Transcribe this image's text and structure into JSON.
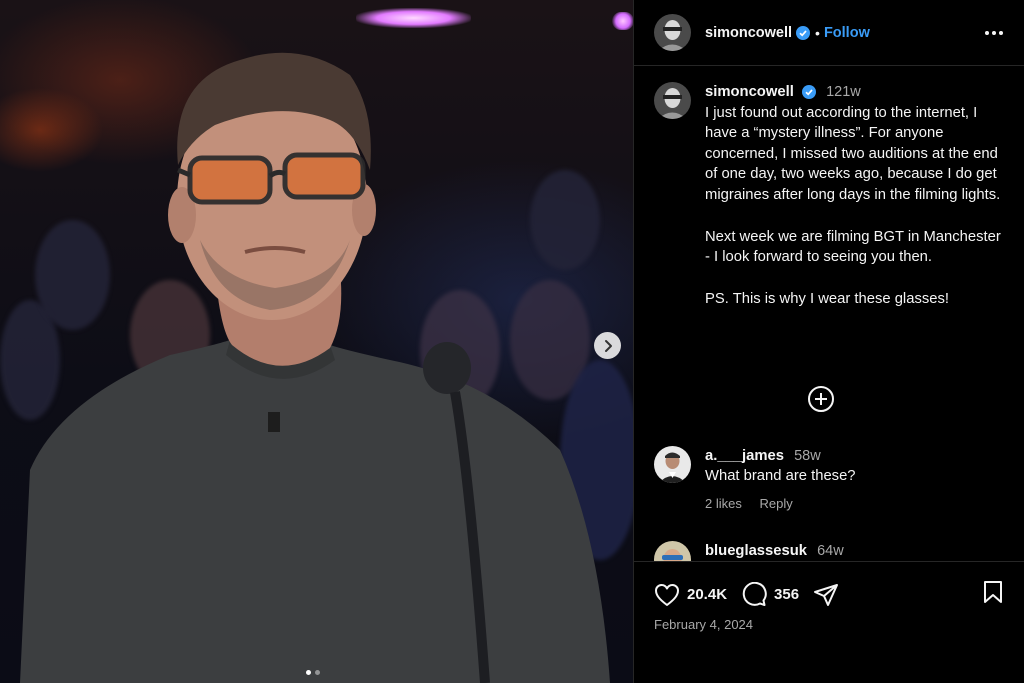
{
  "post": {
    "username": "simoncowell",
    "verified": true,
    "separator": "•",
    "follow_label": "Follow",
    "caption_time": "121w",
    "caption_paragraphs": [
      "I just found out according to the internet, I have a “mystery illness”.  For anyone concerned, I missed two auditions at the end of one day, two weeks ago, because I do get migraines after long days in the filming lights.",
      "Next week we are filming BGT in Manchester - I look forward to seeing you then.",
      "PS. This is why I wear these glasses!"
    ],
    "date": "February 4, 2024"
  },
  "comments": [
    {
      "username": "a.___james",
      "time": "58w",
      "text": "What brand are these?",
      "likes": "2 likes",
      "reply_label": "Reply"
    },
    {
      "username": "blueglassesuk",
      "time": "64w"
    }
  ],
  "actions": {
    "likes_count": "20.4K",
    "comments_count": "356"
  },
  "carousel": {
    "current": 1,
    "total": 2
  },
  "icons": {
    "more": "more-horizontal-icon",
    "add_comments": "plus-circle-icon",
    "like": "heart-icon",
    "comment": "comment-bubble-icon",
    "share": "send-icon",
    "save": "bookmark-icon",
    "next": "chevron-right-icon"
  },
  "colors": {
    "accent": "#3a9cf7",
    "background": "#000000",
    "muted_text": "#a8a8a8"
  }
}
